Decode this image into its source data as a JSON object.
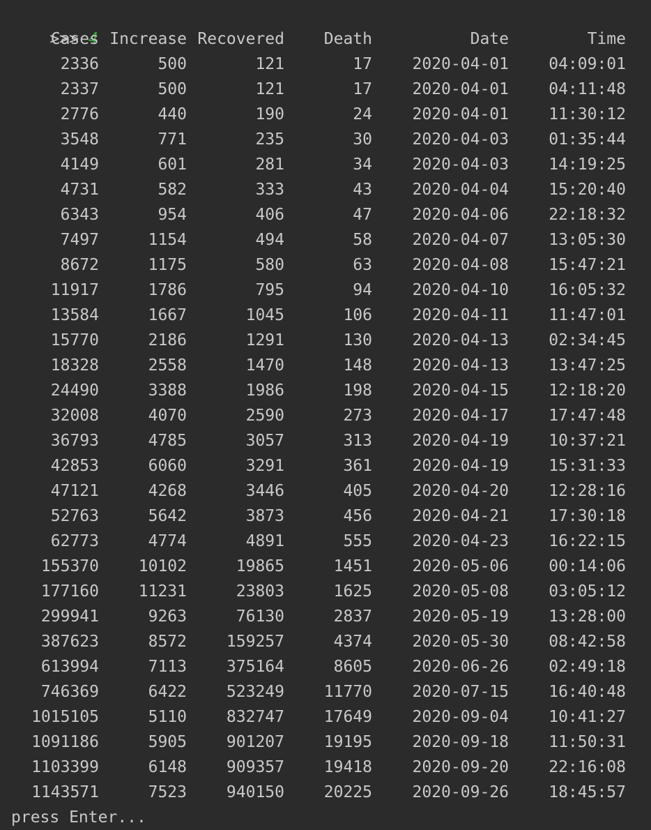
{
  "terminal": {
    "prompt": ">>>",
    "input": "4",
    "footer": "press Enter..."
  },
  "table": {
    "headers": [
      "Cases",
      "Increase",
      "Recovered",
      "Death",
      "Date",
      "Time"
    ],
    "rows": [
      [
        "2336",
        "500",
        "121",
        "17",
        "2020-04-01",
        "04:09:01"
      ],
      [
        "2337",
        "500",
        "121",
        "17",
        "2020-04-01",
        "04:11:48"
      ],
      [
        "2776",
        "440",
        "190",
        "24",
        "2020-04-01",
        "11:30:12"
      ],
      [
        "3548",
        "771",
        "235",
        "30",
        "2020-04-03",
        "01:35:44"
      ],
      [
        "4149",
        "601",
        "281",
        "34",
        "2020-04-03",
        "14:19:25"
      ],
      [
        "4731",
        "582",
        "333",
        "43",
        "2020-04-04",
        "15:20:40"
      ],
      [
        "6343",
        "954",
        "406",
        "47",
        "2020-04-06",
        "22:18:32"
      ],
      [
        "7497",
        "1154",
        "494",
        "58",
        "2020-04-07",
        "13:05:30"
      ],
      [
        "8672",
        "1175",
        "580",
        "63",
        "2020-04-08",
        "15:47:21"
      ],
      [
        "11917",
        "1786",
        "795",
        "94",
        "2020-04-10",
        "16:05:32"
      ],
      [
        "13584",
        "1667",
        "1045",
        "106",
        "2020-04-11",
        "11:47:01"
      ],
      [
        "15770",
        "2186",
        "1291",
        "130",
        "2020-04-13",
        "02:34:45"
      ],
      [
        "18328",
        "2558",
        "1470",
        "148",
        "2020-04-13",
        "13:47:25"
      ],
      [
        "24490",
        "3388",
        "1986",
        "198",
        "2020-04-15",
        "12:18:20"
      ],
      [
        "32008",
        "4070",
        "2590",
        "273",
        "2020-04-17",
        "17:47:48"
      ],
      [
        "36793",
        "4785",
        "3057",
        "313",
        "2020-04-19",
        "10:37:21"
      ],
      [
        "42853",
        "6060",
        "3291",
        "361",
        "2020-04-19",
        "15:31:33"
      ],
      [
        "47121",
        "4268",
        "3446",
        "405",
        "2020-04-20",
        "12:28:16"
      ],
      [
        "52763",
        "5642",
        "3873",
        "456",
        "2020-04-21",
        "17:30:18"
      ],
      [
        "62773",
        "4774",
        "4891",
        "555",
        "2020-04-23",
        "16:22:15"
      ],
      [
        "155370",
        "10102",
        "19865",
        "1451",
        "2020-05-06",
        "00:14:06"
      ],
      [
        "177160",
        "11231",
        "23803",
        "1625",
        "2020-05-08",
        "03:05:12"
      ],
      [
        "299941",
        "9263",
        "76130",
        "2837",
        "2020-05-19",
        "13:28:00"
      ],
      [
        "387623",
        "8572",
        "159257",
        "4374",
        "2020-05-30",
        "08:42:58"
      ],
      [
        "613994",
        "7113",
        "375164",
        "8605",
        "2020-06-26",
        "02:49:18"
      ],
      [
        "746369",
        "6422",
        "523249",
        "11770",
        "2020-07-15",
        "16:40:48"
      ],
      [
        "1015105",
        "5110",
        "832747",
        "17649",
        "2020-09-04",
        "10:41:27"
      ],
      [
        "1091186",
        "5905",
        "901207",
        "19195",
        "2020-09-18",
        "11:50:31"
      ],
      [
        "1103399",
        "6148",
        "909357",
        "19418",
        "2020-09-20",
        "22:16:08"
      ],
      [
        "1143571",
        "7523",
        "940150",
        "20225",
        "2020-09-26",
        "18:45:57"
      ]
    ]
  },
  "colors": {
    "background": "#2b2b2b",
    "text": "#c8c8c8",
    "input": "#3aa63a"
  }
}
